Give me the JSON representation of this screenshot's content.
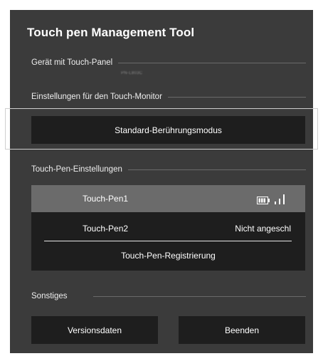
{
  "app": {
    "title": "Touch pen Management Tool"
  },
  "sections": {
    "device_label": "Gerät mit Touch-Panel",
    "device_name": "PN-L803C",
    "monitor_settings_label": "Einstellungen für den Touch-Monitor",
    "pen_settings_label": "Touch-Pen-Einstellungen",
    "misc_label": "Sonstiges"
  },
  "buttons": {
    "standard_mode": "Standard-Berührungsmodus",
    "registration": "Touch-Pen-Registrierung",
    "version": "Versionsdaten",
    "exit": "Beenden"
  },
  "pens": [
    {
      "name": "Touch-Pen1",
      "status": "",
      "battery_icon": "battery-icon",
      "signal_icon": "signal-bars-icon"
    },
    {
      "name": "Touch-Pen2",
      "status": "Nicht angeschl"
    }
  ],
  "colors": {
    "panel": "#3b3b3b",
    "button": "#1e1e1e",
    "selected": "#6b6b6b"
  }
}
